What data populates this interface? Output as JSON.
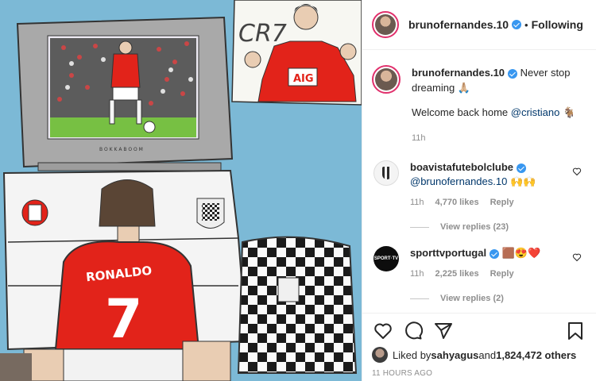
{
  "post": {
    "artwork_label": "CR7",
    "header": {
      "username": "brunofernandes.10",
      "separator": "•",
      "follow_label": "Following"
    },
    "caption": {
      "username": "brunofernandes.10",
      "text": "Never stop dreaming 🙏🏼",
      "line2_prefix": "Welcome back home ",
      "mention": "@cristiano",
      "line2_suffix": " 🐐",
      "time": "11h"
    },
    "comments": [
      {
        "username": "boavistafutebolclube",
        "mention": "@brunofernandes.10",
        "text": " 🙌🙌",
        "time": "11h",
        "likes": "4,770 likes",
        "reply_label": "Reply",
        "view_replies": "View replies (23)"
      },
      {
        "username": "sporttvportugal",
        "mention": "",
        "text": " 🟫😍❤️",
        "time": "11h",
        "likes": "2,225 likes",
        "reply_label": "Reply",
        "view_replies": "View replies (2)"
      }
    ],
    "likes": {
      "prefix": "Liked by ",
      "user": "sahyagus",
      "middle": " and ",
      "count": "1,824,472 others"
    },
    "timestamp": "11 HOURS AGO"
  },
  "icons": {
    "like": "heart-icon",
    "comment": "comment-icon",
    "share": "share-icon",
    "save": "bookmark-icon"
  },
  "colors": {
    "verified": "#3897f0",
    "mention": "#00376b",
    "muted": "#8e8e8e",
    "jersey_red": "#e2231a"
  }
}
